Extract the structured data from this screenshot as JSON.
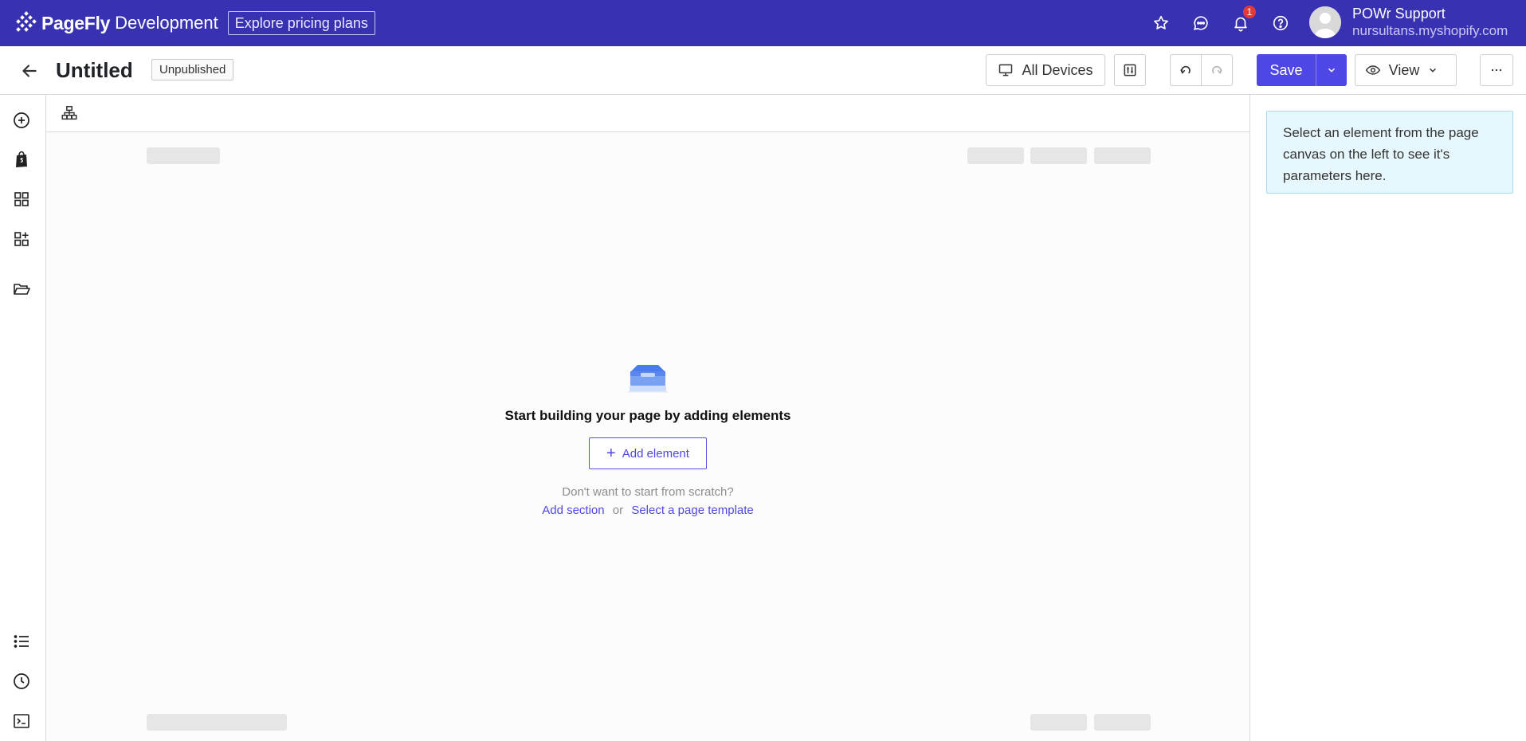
{
  "topbar": {
    "brand": "PageFly",
    "brand_suffix": "Development",
    "pricing_button": "Explore pricing plans",
    "notification_count": "1",
    "user_name": "POWr Support",
    "user_shop": "nursultans.myshopify.com",
    "background_color": "#3832b3"
  },
  "header": {
    "title": "Untitled",
    "status": "Unpublished",
    "devices_label": "All Devices",
    "save_label": "Save",
    "view_label": "View"
  },
  "canvas": {
    "empty_title": "Start building your page by adding elements",
    "add_element_label": "Add element",
    "scratch_text": "Don't want to start from scratch?",
    "add_section_label": "Add section",
    "or_text": "or",
    "template_label": "Select a page template"
  },
  "panel": {
    "info_text": "Select an element from the page canvas on the left to see it's parameters here."
  },
  "icons": {
    "left_rail": [
      "add-circle-icon",
      "shopify-bag-icon",
      "grid-icon",
      "grid-add-icon",
      "folder-open-icon",
      "list-icon",
      "history-clock-icon",
      "terminal-icon"
    ],
    "topbar": [
      "star-icon",
      "chat-icon",
      "bell-icon",
      "help-icon"
    ]
  },
  "colors": {
    "accent": "#4e46e5",
    "info_bg": "#e6f7fd"
  }
}
